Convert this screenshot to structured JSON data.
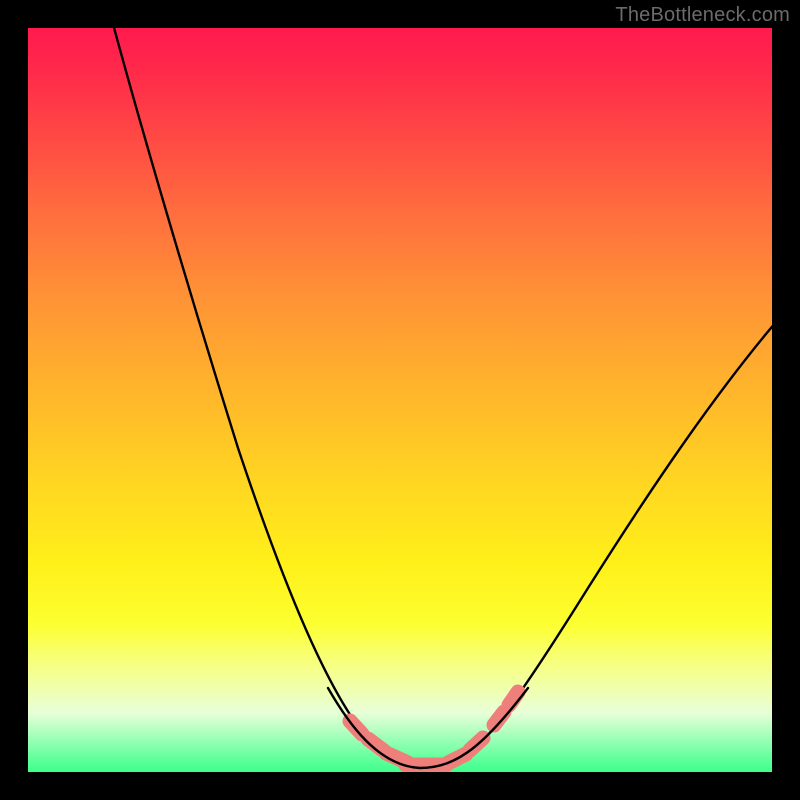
{
  "watermark": "TheBottleneck.com",
  "chart_data": {
    "type": "line",
    "title": "",
    "xlabel": "",
    "ylabel": "",
    "xlim": [
      0,
      100
    ],
    "ylim": [
      0,
      100
    ],
    "grid": false,
    "background_gradient": {
      "top": "#ff1a4e",
      "middle": "#ffd322",
      "bottom": "#3bff8b"
    },
    "series": [
      {
        "name": "bottleneck-curve",
        "note": "Relative bottleneck magnitude (100=worst at top, 0=none at bottom) vs unnamed x parameter (0..100). Values estimated from pixel heights; minimum plateau around x≈50..60.",
        "x": [
          0,
          5,
          10,
          15,
          20,
          25,
          30,
          35,
          40,
          45,
          48,
          50,
          52,
          55,
          58,
          60,
          62,
          65,
          70,
          75,
          80,
          85,
          90,
          95,
          100
        ],
        "values": [
          140,
          120,
          99,
          82,
          66,
          52,
          40,
          29,
          20,
          12,
          7,
          4,
          2,
          1,
          1,
          2,
          4,
          8,
          15,
          22,
          30,
          38,
          46,
          54,
          62
        ]
      }
    ],
    "markers": {
      "note": "Short pink segments overlaid near the curve minimum",
      "color": "#ef7f7a",
      "points_x": [
        45,
        47,
        49,
        51,
        53,
        55,
        57,
        59,
        62,
        64
      ],
      "points_y": [
        8,
        5,
        3,
        2,
        1,
        1,
        2,
        3,
        6,
        9
      ]
    }
  }
}
